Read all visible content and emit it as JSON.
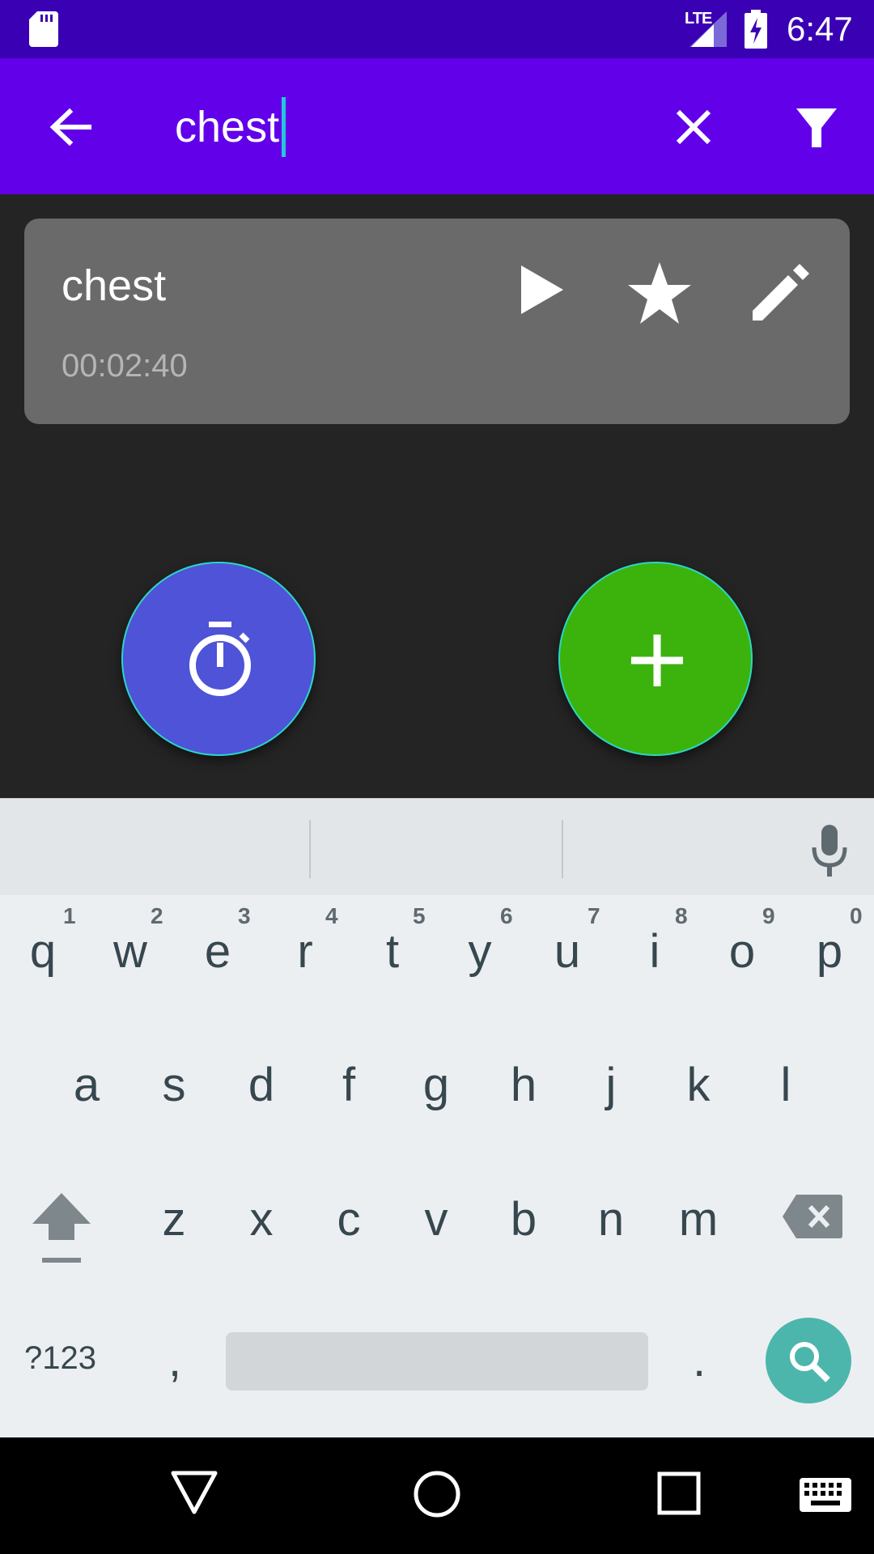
{
  "status_bar": {
    "network": "LTE",
    "time": "6:47",
    "icons": [
      "sd-card-icon",
      "lte-signal-icon",
      "battery-charging-icon"
    ]
  },
  "toolbar": {
    "search_value": "chest",
    "icons": [
      "back-arrow-icon",
      "close-icon",
      "filter-icon"
    ],
    "color": "#6200ea"
  },
  "workouts": [
    {
      "name": "chest",
      "duration": "00:02:40",
      "actions": [
        "play-icon",
        "star-icon",
        "pencil-icon"
      ]
    }
  ],
  "fabs": {
    "timer": {
      "icon": "stopwatch-icon",
      "color": "#4e53d8"
    },
    "add": {
      "icon": "plus-icon",
      "color": "#3cb30c"
    }
  },
  "keyboard": {
    "row1": [
      "q",
      "w",
      "e",
      "r",
      "t",
      "y",
      "u",
      "i",
      "o",
      "p"
    ],
    "row1_hints": [
      "1",
      "2",
      "3",
      "4",
      "5",
      "6",
      "7",
      "8",
      "9",
      "0"
    ],
    "row2": [
      "a",
      "s",
      "d",
      "f",
      "g",
      "h",
      "j",
      "k",
      "l"
    ],
    "row3": [
      "z",
      "x",
      "c",
      "v",
      "b",
      "n",
      "m"
    ],
    "symbols_label": "?123",
    "comma": ",",
    "period": ".",
    "action_color": "#4db6ac"
  },
  "nav_bar": {
    "icons": [
      "back-triangle-icon",
      "home-circle-icon",
      "recents-square-icon",
      "keyboard-switch-icon"
    ]
  }
}
